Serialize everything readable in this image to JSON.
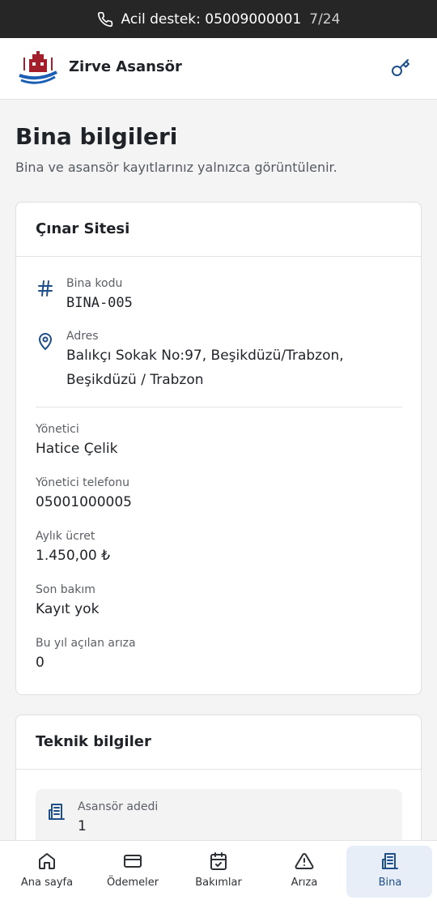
{
  "emergency": {
    "text": "Acil destek: 05009000001",
    "hours": "7/24"
  },
  "header": {
    "brand": "Zirve Asansör"
  },
  "page": {
    "title": "Bina bilgileri",
    "subtitle": "Bina ve asansör kayıtlarınız yalnızca görüntülenir."
  },
  "building": {
    "name": "Çınar Sitesi",
    "code_label": "Bina kodu",
    "code": "BINA-005",
    "address_label": "Adres",
    "address": "Balıkçı Sokak No:97, Beşikdüzü/Trabzon, Beşikdüzü / Trabzon",
    "manager_label": "Yönetici",
    "manager": "Hatice Çelik",
    "manager_phone_label": "Yönetici telefonu",
    "manager_phone": "05001000005",
    "monthly_fee_label": "Aylık ücret",
    "monthly_fee": "1.450,00 ₺",
    "last_service_label": "Son bakım",
    "last_service": "Kayıt yok",
    "faults_label": "Bu yıl açılan arıza",
    "faults": "0"
  },
  "technical": {
    "title": "Teknik bilgiler",
    "elevator_count_label": "Asansör adedi",
    "elevator_count": "1"
  },
  "nav": {
    "items": [
      {
        "label": "Ana sayfa",
        "icon": "home-icon"
      },
      {
        "label": "Ödemeler",
        "icon": "card-icon"
      },
      {
        "label": "Bakımlar",
        "icon": "calendar-check-icon"
      },
      {
        "label": "Arıza",
        "icon": "warning-icon"
      },
      {
        "label": "Bina",
        "icon": "building-icon",
        "active": true
      }
    ]
  },
  "colors": {
    "accent": "#1f4f8a",
    "topbar": "#262626",
    "active_tab_bg": "#e7eef8"
  }
}
